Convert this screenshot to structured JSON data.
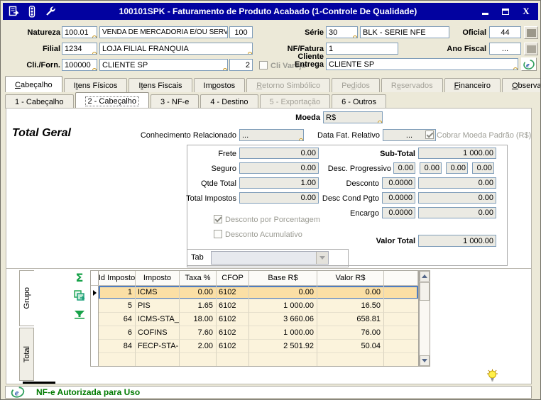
{
  "titlebar": {
    "title": "100101SPK - Faturamento de Produto Acabado (1-Controle De Qualidade)",
    "icons": [
      {
        "name": "document-icon"
      },
      {
        "name": "traffic-light-icon"
      },
      {
        "name": "wrench-icon"
      }
    ],
    "controls": [
      {
        "name": "minimize-button"
      },
      {
        "name": "maximize-button"
      },
      {
        "name": "close-button"
      }
    ],
    "color": "#0202A0"
  },
  "form": {
    "natureza_label": "Natureza",
    "natureza_code": "100.01",
    "natureza_desc": "VENDA DE MERCADORIA E/OU SERVI",
    "natureza_extra": "100",
    "filial_label": "Filial",
    "filial_code": "1234",
    "filial_desc": "LOJA FILIAL FRANQUIA",
    "cli_forn_label": "Cli./Forn.",
    "cli_forn_code": "100000",
    "cli_forn_desc": "CLIENTE SP",
    "cli_forn_extra": "2",
    "cli_varejo_label": "Cli Varejo",
    "serie_label": "Série",
    "serie_code": "30",
    "serie_desc": "BLK - SERIE NFE",
    "oficial_label": "Oficial",
    "oficial_value": "44",
    "nf_fatura_label": "NF/Fatura",
    "nf_fatura_value": "1",
    "ano_fiscal_label": "Ano Fiscal",
    "ano_fiscal_value": "...",
    "cliente_entrega_label_1": "Cliente",
    "cliente_entrega_label_2": "Entrega",
    "cliente_entrega_value": "CLIENTE SP"
  },
  "tabs": {
    "main": [
      {
        "label": "Cabeçalho",
        "u": 0,
        "active": true,
        "disabled": false
      },
      {
        "label": "Itens Físicos",
        "u": 1,
        "active": false,
        "disabled": false
      },
      {
        "label": "Itens Fiscais",
        "u": 1,
        "active": false,
        "disabled": false
      },
      {
        "label": "Impostos",
        "u": 2,
        "active": false,
        "disabled": false
      },
      {
        "label": "Retorno Simbólico",
        "u": 0,
        "active": false,
        "disabled": true
      },
      {
        "label": "Pedidos",
        "u": 2,
        "active": false,
        "disabled": true
      },
      {
        "label": "Reservados",
        "u": 1,
        "active": false,
        "disabled": true
      },
      {
        "label": "Financeiro",
        "u": 0,
        "active": false,
        "disabled": false
      },
      {
        "label": "Observações",
        "u": 0,
        "active": false,
        "disabled": false
      }
    ],
    "sub": [
      {
        "label": "1 - Cabeçalho",
        "active": false,
        "disabled": false
      },
      {
        "label": "2 - Cabeçalho",
        "active": true,
        "disabled": false
      },
      {
        "label": "3 - NF-e",
        "active": false,
        "disabled": false
      },
      {
        "label": "4 - Destino",
        "active": false,
        "disabled": false
      },
      {
        "label": "5 - Exportação",
        "active": false,
        "disabled": true
      },
      {
        "label": "6 - Outros",
        "active": false,
        "disabled": false
      }
    ]
  },
  "page": {
    "section_title": "Total Geral",
    "moeda_label": "Moeda",
    "moeda_value": "R$",
    "conhecimento_label": "Conhecimento Relacionado",
    "conhecimento_value": "...",
    "data_fat_label": "Data Fat. Relativo",
    "data_fat_value": "...",
    "cobrar_moeda_label": "Cobrar Moeda Padrão (R$)",
    "cobrar_moeda_checked": true,
    "totals_left": [
      {
        "label": "Frete",
        "value": "0.00"
      },
      {
        "label": "Seguro",
        "value": "0.00"
      },
      {
        "label": "Qtde Total",
        "value": "1.00"
      },
      {
        "label": "Total Impostos",
        "value": "0.00"
      }
    ],
    "checkboxes": [
      {
        "label": "Desconto por Porcentagem",
        "checked": true
      },
      {
        "label": "Desconto Acumulativo",
        "checked": false
      }
    ],
    "sub_total_label": "Sub-Total",
    "sub_total_value": "1 000.00",
    "desc_progressivo_label": "Desc. Progressivo",
    "desc_progressivo_values": [
      "0.00",
      "0.00",
      "0.00",
      "0.00"
    ],
    "pct_rows": [
      {
        "label": "Desconto",
        "pct": "0.0000",
        "value": "0.00"
      },
      {
        "label": "Desc Cond Pgto",
        "pct": "0.0000",
        "value": "0.00"
      },
      {
        "label": "Encargo",
        "pct": "0.0000",
        "value": "0.00"
      }
    ],
    "valor_total_label": "Valor Total",
    "valor_total_value": "1 000.00",
    "tab_combo_label": "Tab"
  },
  "grid": {
    "side_tabs": [
      {
        "label": "Grupo",
        "active": true
      },
      {
        "label": "Total",
        "active": false
      }
    ],
    "tools": [
      {
        "name": "sum-icon"
      },
      {
        "name": "copy-icon"
      },
      {
        "name": "filter-icon"
      }
    ],
    "columns": [
      "Id Imposto",
      "Imposto",
      "Taxa %",
      "CFOP",
      "Base R$",
      "Valor R$"
    ],
    "rows": [
      [
        "1",
        "ICMS",
        "0.00",
        "6102",
        "0.00",
        "0.00"
      ],
      [
        "5",
        "PIS",
        "1.65",
        "6102",
        "1 000.00",
        "16.50"
      ],
      [
        "64",
        "ICMS-STA_R",
        "18.00",
        "6102",
        "3 660.06",
        "658.81"
      ],
      [
        "6",
        "COFINS",
        "7.60",
        "6102",
        "1 000.00",
        "76.00"
      ],
      [
        "84",
        "FECP-STA-R",
        "2.00",
        "6102",
        "2 501.92",
        "50.04"
      ]
    ],
    "selected_row": 0,
    "colors": {
      "row_bg": "#FBF3DC",
      "selected_bg": "#FBDFA5",
      "selected_border": "#4F7DC0",
      "icon_green": "#18A24A"
    }
  },
  "statusbar": {
    "message": "NF-e Autorizada para Uso",
    "icon": "nfe-icon",
    "text_color": "#007A00"
  }
}
